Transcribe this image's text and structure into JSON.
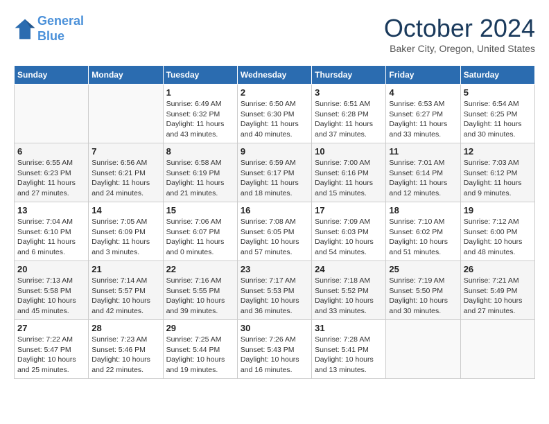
{
  "header": {
    "logo_line1": "General",
    "logo_line2": "Blue",
    "month": "October 2024",
    "location": "Baker City, Oregon, United States"
  },
  "days_of_week": [
    "Sunday",
    "Monday",
    "Tuesday",
    "Wednesday",
    "Thursday",
    "Friday",
    "Saturday"
  ],
  "weeks": [
    [
      {
        "day": "",
        "info": ""
      },
      {
        "day": "",
        "info": ""
      },
      {
        "day": "1",
        "info": "Sunrise: 6:49 AM\nSunset: 6:32 PM\nDaylight: 11 hours and 43 minutes."
      },
      {
        "day": "2",
        "info": "Sunrise: 6:50 AM\nSunset: 6:30 PM\nDaylight: 11 hours and 40 minutes."
      },
      {
        "day": "3",
        "info": "Sunrise: 6:51 AM\nSunset: 6:28 PM\nDaylight: 11 hours and 37 minutes."
      },
      {
        "day": "4",
        "info": "Sunrise: 6:53 AM\nSunset: 6:27 PM\nDaylight: 11 hours and 33 minutes."
      },
      {
        "day": "5",
        "info": "Sunrise: 6:54 AM\nSunset: 6:25 PM\nDaylight: 11 hours and 30 minutes."
      }
    ],
    [
      {
        "day": "6",
        "info": "Sunrise: 6:55 AM\nSunset: 6:23 PM\nDaylight: 11 hours and 27 minutes."
      },
      {
        "day": "7",
        "info": "Sunrise: 6:56 AM\nSunset: 6:21 PM\nDaylight: 11 hours and 24 minutes."
      },
      {
        "day": "8",
        "info": "Sunrise: 6:58 AM\nSunset: 6:19 PM\nDaylight: 11 hours and 21 minutes."
      },
      {
        "day": "9",
        "info": "Sunrise: 6:59 AM\nSunset: 6:17 PM\nDaylight: 11 hours and 18 minutes."
      },
      {
        "day": "10",
        "info": "Sunrise: 7:00 AM\nSunset: 6:16 PM\nDaylight: 11 hours and 15 minutes."
      },
      {
        "day": "11",
        "info": "Sunrise: 7:01 AM\nSunset: 6:14 PM\nDaylight: 11 hours and 12 minutes."
      },
      {
        "day": "12",
        "info": "Sunrise: 7:03 AM\nSunset: 6:12 PM\nDaylight: 11 hours and 9 minutes."
      }
    ],
    [
      {
        "day": "13",
        "info": "Sunrise: 7:04 AM\nSunset: 6:10 PM\nDaylight: 11 hours and 6 minutes."
      },
      {
        "day": "14",
        "info": "Sunrise: 7:05 AM\nSunset: 6:09 PM\nDaylight: 11 hours and 3 minutes."
      },
      {
        "day": "15",
        "info": "Sunrise: 7:06 AM\nSunset: 6:07 PM\nDaylight: 11 hours and 0 minutes."
      },
      {
        "day": "16",
        "info": "Sunrise: 7:08 AM\nSunset: 6:05 PM\nDaylight: 10 hours and 57 minutes."
      },
      {
        "day": "17",
        "info": "Sunrise: 7:09 AM\nSunset: 6:03 PM\nDaylight: 10 hours and 54 minutes."
      },
      {
        "day": "18",
        "info": "Sunrise: 7:10 AM\nSunset: 6:02 PM\nDaylight: 10 hours and 51 minutes."
      },
      {
        "day": "19",
        "info": "Sunrise: 7:12 AM\nSunset: 6:00 PM\nDaylight: 10 hours and 48 minutes."
      }
    ],
    [
      {
        "day": "20",
        "info": "Sunrise: 7:13 AM\nSunset: 5:58 PM\nDaylight: 10 hours and 45 minutes."
      },
      {
        "day": "21",
        "info": "Sunrise: 7:14 AM\nSunset: 5:57 PM\nDaylight: 10 hours and 42 minutes."
      },
      {
        "day": "22",
        "info": "Sunrise: 7:16 AM\nSunset: 5:55 PM\nDaylight: 10 hours and 39 minutes."
      },
      {
        "day": "23",
        "info": "Sunrise: 7:17 AM\nSunset: 5:53 PM\nDaylight: 10 hours and 36 minutes."
      },
      {
        "day": "24",
        "info": "Sunrise: 7:18 AM\nSunset: 5:52 PM\nDaylight: 10 hours and 33 minutes."
      },
      {
        "day": "25",
        "info": "Sunrise: 7:19 AM\nSunset: 5:50 PM\nDaylight: 10 hours and 30 minutes."
      },
      {
        "day": "26",
        "info": "Sunrise: 7:21 AM\nSunset: 5:49 PM\nDaylight: 10 hours and 27 minutes."
      }
    ],
    [
      {
        "day": "27",
        "info": "Sunrise: 7:22 AM\nSunset: 5:47 PM\nDaylight: 10 hours and 25 minutes."
      },
      {
        "day": "28",
        "info": "Sunrise: 7:23 AM\nSunset: 5:46 PM\nDaylight: 10 hours and 22 minutes."
      },
      {
        "day": "29",
        "info": "Sunrise: 7:25 AM\nSunset: 5:44 PM\nDaylight: 10 hours and 19 minutes."
      },
      {
        "day": "30",
        "info": "Sunrise: 7:26 AM\nSunset: 5:43 PM\nDaylight: 10 hours and 16 minutes."
      },
      {
        "day": "31",
        "info": "Sunrise: 7:28 AM\nSunset: 5:41 PM\nDaylight: 10 hours and 13 minutes."
      },
      {
        "day": "",
        "info": ""
      },
      {
        "day": "",
        "info": ""
      }
    ]
  ]
}
